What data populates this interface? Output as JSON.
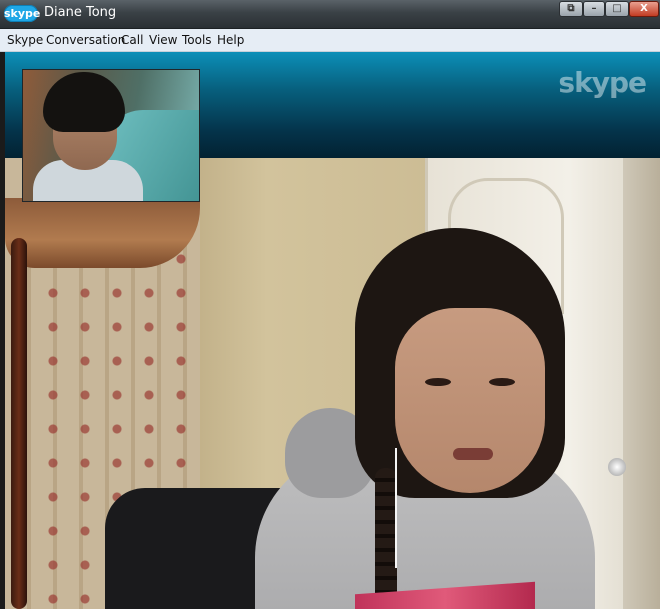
{
  "window": {
    "app_logo_text": "skype",
    "title": "Diane Tong",
    "controls": {
      "restore": "⧉",
      "minimize": "–",
      "maximize": "□",
      "close": "X"
    }
  },
  "menubar": {
    "items": [
      "Skype",
      "Conversation",
      "Call",
      "View",
      "Tools",
      "Help"
    ]
  },
  "call": {
    "brand_watermark": "skype"
  },
  "colors": {
    "banner_top": "#0c8fb8",
    "banner_bottom": "#022232",
    "menubar_bg": "#e6edf5",
    "skype_blue": "#1fa7e6"
  }
}
